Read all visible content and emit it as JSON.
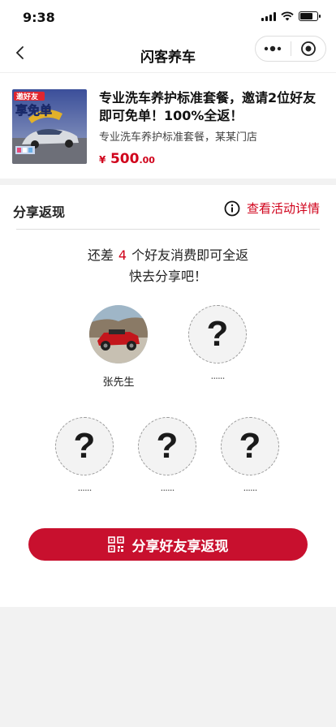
{
  "status_bar": {
    "time": "9:38"
  },
  "nav": {
    "title": "闪客养车"
  },
  "product": {
    "thumb_banner": "邀好友享免单",
    "title": "专业洗车养护标准套餐，邀请2位好友即可免单！100%全返！",
    "subtitle": "专业洗车养护标准套餐，某某门店",
    "price_currency": "¥",
    "price_int": "500",
    "price_dec": ".00"
  },
  "share": {
    "heading": "分享返现",
    "detail_link": "查看活动详情",
    "message_prefix": "还差",
    "remaining": "4",
    "message_suffix": "个好友消费即可全返",
    "message_line2": "快去分享吧！",
    "friends": [
      {
        "name": "张先生",
        "filled": true
      },
      {
        "name": "......",
        "filled": false
      },
      {
        "name": "......",
        "filled": false
      },
      {
        "name": "......",
        "filled": false
      },
      {
        "name": "......",
        "filled": false
      }
    ],
    "placeholder_glyph": "?",
    "button_label": "分享好友享返现"
  },
  "colors": {
    "accent": "#d0021b",
    "button": "#c8102e",
    "background": "#f2f2f2"
  },
  "icons": [
    "back-icon",
    "more-icon",
    "close-target-icon",
    "info-icon",
    "qr-code-icon"
  ]
}
